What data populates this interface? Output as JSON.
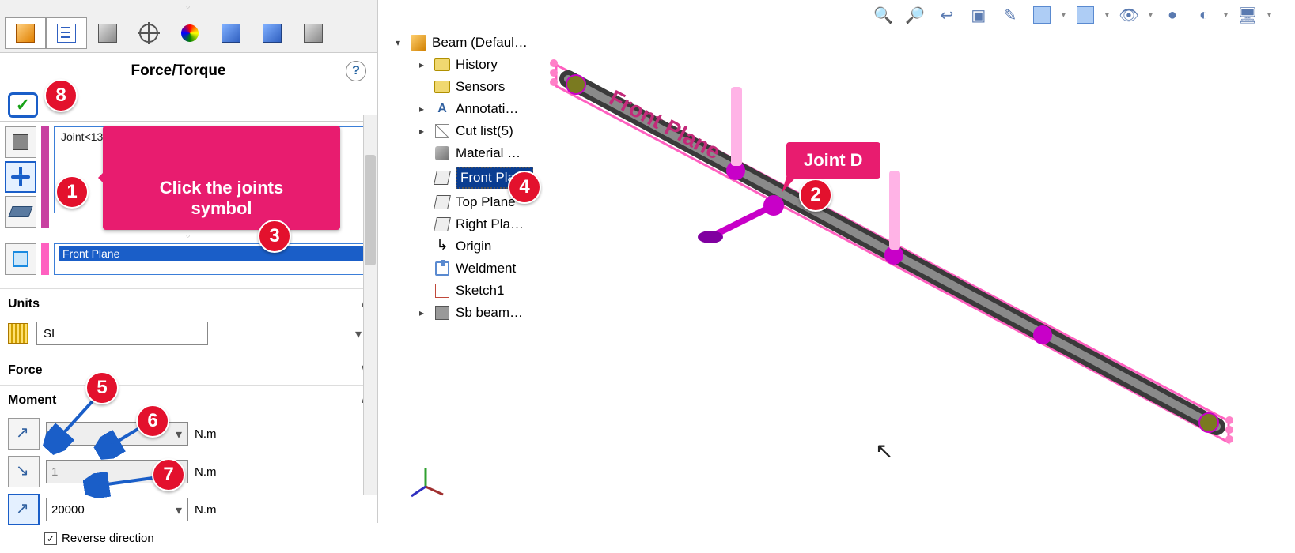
{
  "panel": {
    "title": "Force/Torque",
    "joint_item": "Joint<13, 1>",
    "ref_item": "Front Plane",
    "units_label": "Units",
    "units_value": "SI",
    "force_label": "Force",
    "moment_label": "Moment",
    "moment_unit": "N.m",
    "m1_value": "1",
    "m2_value": "1",
    "m3_value": "20000",
    "reverse_label": "Reverse direction"
  },
  "tree": {
    "root": "Beam  (Defaul…",
    "items": [
      {
        "label": "History",
        "ico": "folder",
        "exp": "▸"
      },
      {
        "label": "Sensors",
        "ico": "folder",
        "exp": ""
      },
      {
        "label": "Annotati…",
        "ico": "ann",
        "exp": "▸"
      },
      {
        "label": "Cut list(5)",
        "ico": "cut",
        "exp": "▸"
      },
      {
        "label": "Material …",
        "ico": "mat",
        "exp": ""
      },
      {
        "label": "Front Pla…",
        "ico": "plane",
        "exp": "",
        "sel": true
      },
      {
        "label": "Top Plane",
        "ico": "plane",
        "exp": ""
      },
      {
        "label": "Right Pla…",
        "ico": "plane",
        "exp": ""
      },
      {
        "label": "Origin",
        "ico": "origin",
        "exp": ""
      },
      {
        "label": "Weldment",
        "ico": "weld",
        "exp": ""
      },
      {
        "label": "Sketch1",
        "ico": "sketch",
        "exp": ""
      },
      {
        "label": "Sb beam…",
        "ico": "sbeam",
        "exp": "▸"
      }
    ]
  },
  "ann": {
    "callout_joints": "Click the joints\nsymbol",
    "callout_jointD": "Joint D",
    "b1": "1",
    "b2": "2",
    "b3": "3",
    "b4": "4",
    "b5": "5",
    "b6": "6",
    "b7": "7",
    "b8": "8"
  },
  "viewport_label": "Front Plane"
}
